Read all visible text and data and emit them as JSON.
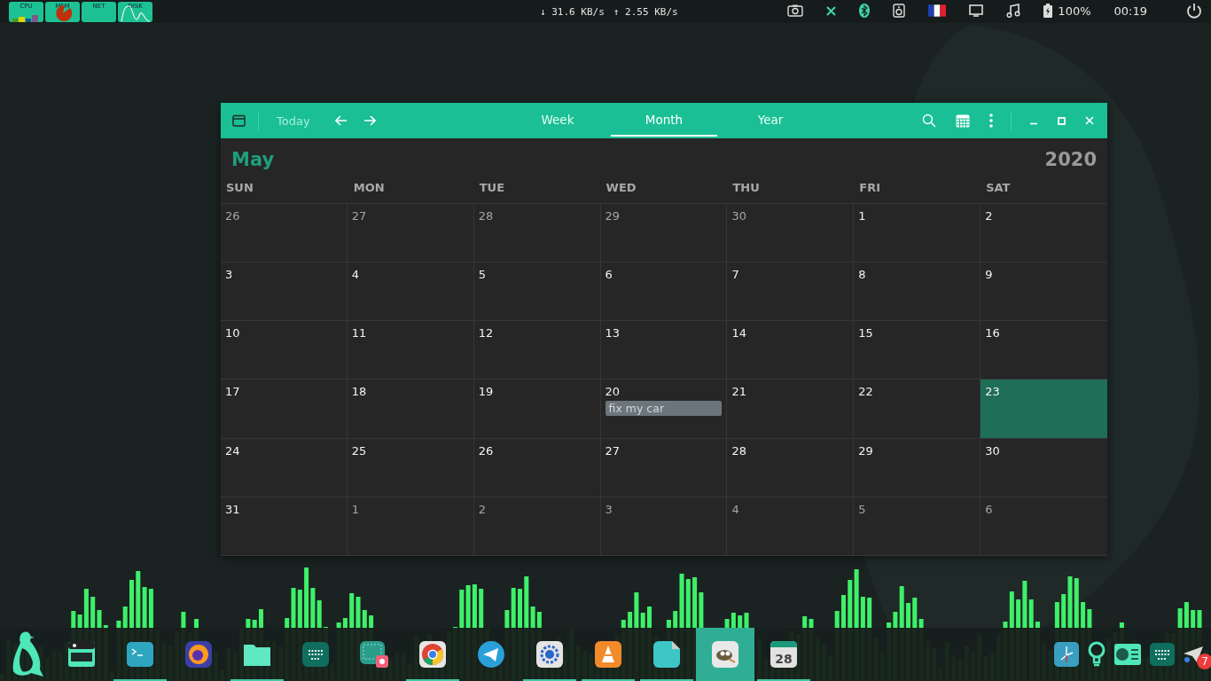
{
  "top_bar": {
    "widgets": [
      {
        "label": "CPU"
      },
      {
        "label": "MEM"
      },
      {
        "label": "NET"
      },
      {
        "label": "DISK"
      }
    ],
    "network": {
      "down": "↓ 31.6 KB/s",
      "up": "↑ 2.55 KB/s"
    },
    "battery": "100%",
    "clock": "00:19"
  },
  "calendar": {
    "today_button": {
      "label": "Today",
      "disabled": true
    },
    "views": [
      {
        "label": "Week",
        "selected": false
      },
      {
        "label": "Month",
        "selected": true
      },
      {
        "label": "Year",
        "selected": false
      }
    ],
    "month": "May",
    "year": "2020",
    "weekdays": [
      "SUN",
      "MON",
      "TUE",
      "WED",
      "THU",
      "FRI",
      "SAT"
    ],
    "weeks": [
      [
        {
          "day": "26",
          "other_month": true,
          "today": false
        },
        {
          "day": "27",
          "other_month": true,
          "today": false
        },
        {
          "day": "28",
          "other_month": true,
          "today": false
        },
        {
          "day": "29",
          "other_month": true,
          "today": false
        },
        {
          "day": "30",
          "other_month": true,
          "today": false
        },
        {
          "day": "1",
          "other_month": false,
          "today": false
        },
        {
          "day": "2",
          "other_month": false,
          "today": false
        }
      ],
      [
        {
          "day": "3",
          "other_month": false,
          "today": false
        },
        {
          "day": "4",
          "other_month": false,
          "today": false
        },
        {
          "day": "5",
          "other_month": false,
          "today": false
        },
        {
          "day": "6",
          "other_month": false,
          "today": false
        },
        {
          "day": "7",
          "other_month": false,
          "today": false
        },
        {
          "day": "8",
          "other_month": false,
          "today": false
        },
        {
          "day": "9",
          "other_month": false,
          "today": false
        }
      ],
      [
        {
          "day": "10",
          "other_month": false,
          "today": false
        },
        {
          "day": "11",
          "other_month": false,
          "today": false
        },
        {
          "day": "12",
          "other_month": false,
          "today": false
        },
        {
          "day": "13",
          "other_month": false,
          "today": false
        },
        {
          "day": "14",
          "other_month": false,
          "today": false
        },
        {
          "day": "15",
          "other_month": false,
          "today": false
        },
        {
          "day": "16",
          "other_month": false,
          "today": false
        }
      ],
      [
        {
          "day": "17",
          "other_month": false,
          "today": false
        },
        {
          "day": "18",
          "other_month": false,
          "today": false
        },
        {
          "day": "19",
          "other_month": false,
          "today": false
        },
        {
          "day": "20",
          "other_month": false,
          "today": false,
          "events": [
            "fix my car"
          ]
        },
        {
          "day": "21",
          "other_month": false,
          "today": false
        },
        {
          "day": "22",
          "other_month": false,
          "today": false
        },
        {
          "day": "23",
          "other_month": false,
          "today": true
        }
      ],
      [
        {
          "day": "24",
          "other_month": false,
          "today": false
        },
        {
          "day": "25",
          "other_month": false,
          "today": false
        },
        {
          "day": "26",
          "other_month": false,
          "today": false
        },
        {
          "day": "27",
          "other_month": false,
          "today": false
        },
        {
          "day": "28",
          "other_month": false,
          "today": false
        },
        {
          "day": "29",
          "other_month": false,
          "today": false
        },
        {
          "day": "30",
          "other_month": false,
          "today": false
        }
      ],
      [
        {
          "day": "31",
          "other_month": false,
          "today": false
        },
        {
          "day": "1",
          "other_month": true,
          "today": false
        },
        {
          "day": "2",
          "other_month": true,
          "today": false
        },
        {
          "day": "3",
          "other_month": true,
          "today": false
        },
        {
          "day": "4",
          "other_month": true,
          "today": false
        },
        {
          "day": "5",
          "other_month": true,
          "today": false
        },
        {
          "day": "6",
          "other_month": true,
          "today": false
        }
      ]
    ]
  },
  "dock": {
    "apps": [
      {
        "running": false,
        "selected": false
      },
      {
        "running": true,
        "selected": false
      },
      {
        "running": false,
        "selected": false
      },
      {
        "running": true,
        "selected": false
      },
      {
        "running": false,
        "selected": false
      },
      {
        "running": false,
        "selected": false
      },
      {
        "running": true,
        "selected": false
      },
      {
        "running": false,
        "selected": false
      },
      {
        "running": true,
        "selected": false
      },
      {
        "running": true,
        "selected": false
      },
      {
        "running": true,
        "selected": false
      },
      {
        "running": false,
        "selected": true
      },
      {
        "running": true,
        "selected": false,
        "icon_text": "28"
      }
    ],
    "badge": "7"
  }
}
